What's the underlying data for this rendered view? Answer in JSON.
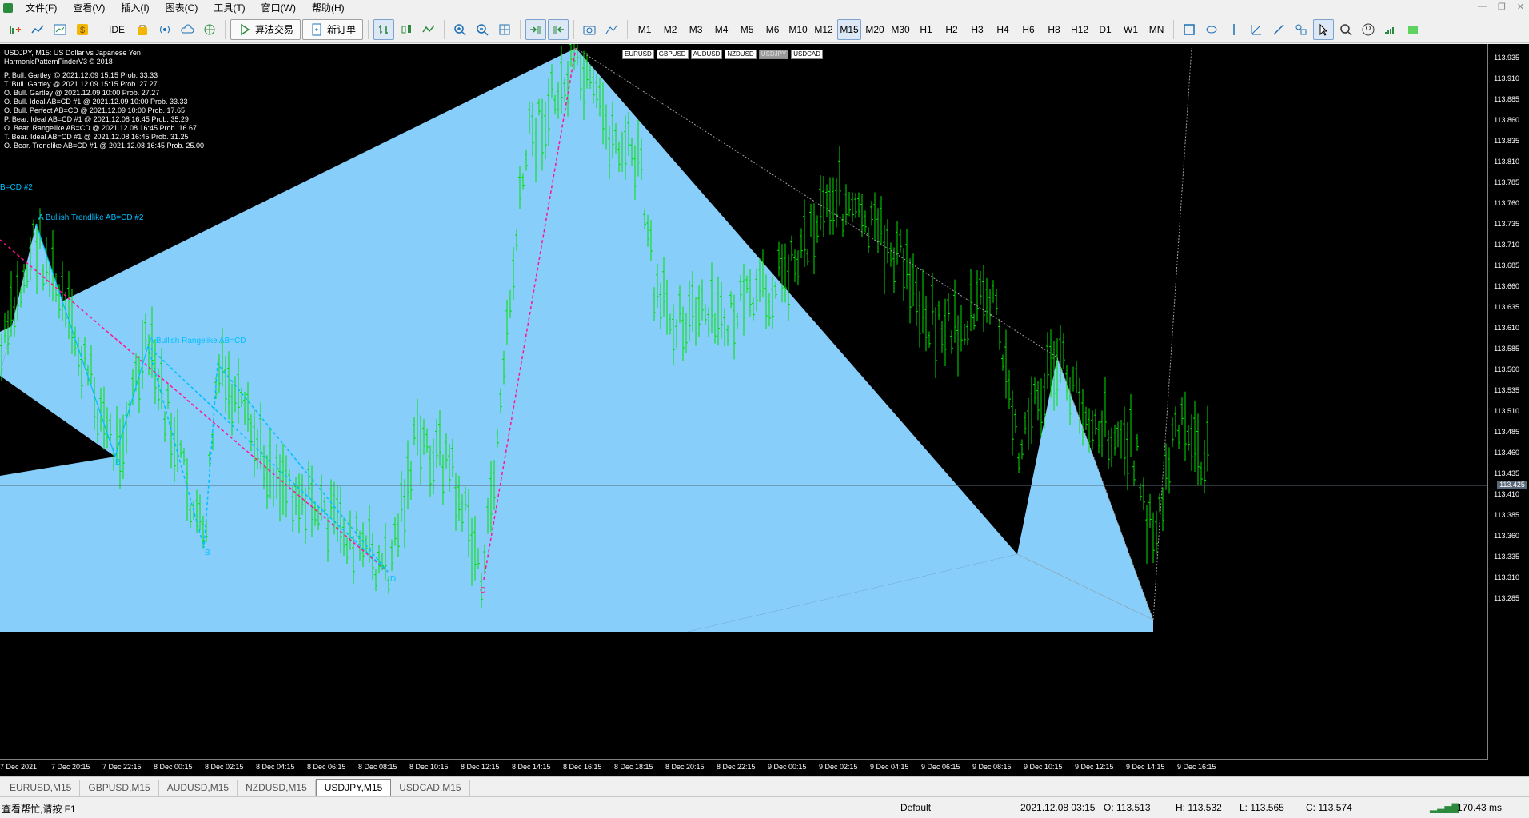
{
  "menubar": {
    "items": [
      "文件(F)",
      "查看(V)",
      "插入(I)",
      "图表(C)",
      "工具(T)",
      "窗口(W)",
      "帮助(H)"
    ]
  },
  "toolbar": {
    "ide_label": "IDE",
    "algo_label": "算法交易",
    "new_order_label": "新订单",
    "timeframes": [
      "M1",
      "M2",
      "M3",
      "M4",
      "M5",
      "M6",
      "M10",
      "M12",
      "M15",
      "M20",
      "M30",
      "H1",
      "H2",
      "H3",
      "H4",
      "H6",
      "H8",
      "H12",
      "D1",
      "W1",
      "MN"
    ],
    "active_timeframe": "M15"
  },
  "chart": {
    "title": "USDJPY, M15:  US Dollar vs Japanese Yen",
    "indicator": "HarmonicPatternFinderV3 © 2018",
    "patterns": [
      "P. Bull. Gartley @ 2021.12.09 15:15 Prob. 33.33",
      "T. Bull. Gartley @ 2021.12.09 15:15 Prob. 27.27",
      "O. Bull. Gartley @ 2021.12.09 10:00 Prob. 27.27",
      "O. Bull. Ideal AB=CD #1 @ 2021.12.09 10:00 Prob. 33.33",
      "O. Bull. Perfect AB=CD @ 2021.12.09 10:00 Prob. 17.65",
      "P. Bear. Ideal AB=CD #1 @ 2021.12.08 16:45 Prob. 35.29",
      "O. Bear. Rangelike AB=CD @ 2021.12.08 16:45 Prob. 16.67",
      "T. Bear. Ideal AB=CD #1 @ 2021.12.08 16:45 Prob. 31.25",
      "O. Bear. Trendlike AB=CD #1 @ 2021.12.08 16:45 Prob. 25.00"
    ],
    "symbol_tabs": [
      "EURUSD",
      "GBPUSD",
      "AUDUSD",
      "NZDUSD",
      "USDJPY",
      "USDCAD"
    ],
    "active_symbol": "USDJPY",
    "price_levels": [
      "113.935",
      "113.910",
      "113.885",
      "113.860",
      "113.835",
      "113.810",
      "113.785",
      "113.760",
      "113.735",
      "113.710",
      "113.685",
      "113.660",
      "113.635",
      "113.610",
      "113.585",
      "113.560",
      "113.535",
      "113.510",
      "113.485",
      "113.460",
      "113.435",
      "113.410",
      "113.385",
      "113.360",
      "113.335",
      "113.310",
      "113.285"
    ],
    "current_price": "113.425",
    "time_labels": [
      "7 Dec 2021",
      "7 Dec 20:15",
      "7 Dec 22:15",
      "8 Dec 00:15",
      "8 Dec 02:15",
      "8 Dec 04:15",
      "8 Dec 06:15",
      "8 Dec 08:15",
      "8 Dec 10:15",
      "8 Dec 12:15",
      "8 Dec 14:15",
      "8 Dec 16:15",
      "8 Dec 18:15",
      "8 Dec 20:15",
      "8 Dec 22:15",
      "9 Dec 00:15",
      "9 Dec 02:15",
      "9 Dec 04:15",
      "9 Dec 06:15",
      "9 Dec 08:15",
      "9 Dec 10:15",
      "9 Dec 12:15",
      "9 Dec 14:15",
      "9 Dec 16:15"
    ],
    "labels": {
      "trendlike": "A Bullish Trendlike AB=CD #2",
      "rangelike": "A Bullish Rangelike AB=CD",
      "cut": "B=CD #2",
      "b1": "B",
      "b2": "B",
      "b3": "B",
      "d1": "D",
      "c1": "C",
      "b4": "B",
      "c_top": "C",
      "d_bottom": "D"
    },
    "colors": {
      "pattern_fill": "#87cefa",
      "candle": "#00e000",
      "pink_line": "#ff1493",
      "blue_line": "#00bfff",
      "background": "#000000"
    }
  },
  "chart_tabs": [
    "EURUSD,M15",
    "GBPUSD,M15",
    "AUDUSD,M15",
    "NZDUSD,M15",
    "USDJPY,M15",
    "USDCAD,M15"
  ],
  "active_chart_tab": "USDJPY,M15",
  "status": {
    "help": "查看帮忙,请按 F1",
    "profile": "Default",
    "datetime": "2021.12.08 03:15",
    "open": "O: 113.513",
    "high": "H: 113.532",
    "low": "L: 113.565",
    "close": "C: 113.574",
    "ping": "170.43 ms"
  }
}
